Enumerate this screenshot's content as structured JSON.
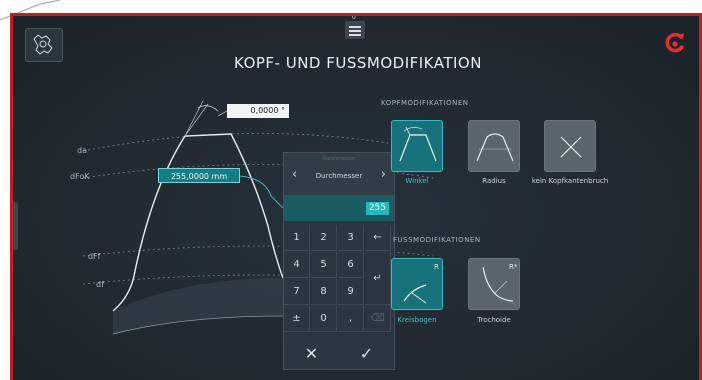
{
  "title": "KOPF- UND FUSSMODIFIKATION",
  "menu_badge": "0",
  "diagram": {
    "angle_value": "0,0000 °",
    "dfok_value": "255,0000 mm",
    "labels": {
      "da": "da",
      "dfok": "dFoK",
      "dff": "dFf",
      "df": "df"
    }
  },
  "keypad": {
    "small_caption": "Durchmesser",
    "mode_label": "Durchmesser",
    "entry_value": "255",
    "keys": [
      "1",
      "2",
      "3",
      "←",
      "4",
      "5",
      "6",
      "↵",
      "7",
      "8",
      "9",
      "",
      "±",
      "0",
      ",",
      "⌫"
    ],
    "cancel_symbol": "✕",
    "confirm_symbol": "✓"
  },
  "kopf": {
    "section_label": "KOPFMODIFIKATIONEN",
    "options": [
      {
        "label": "Winkel",
        "active": true
      },
      {
        "label": "Radius",
        "active": false
      },
      {
        "label": "kein Kopfkantenbruch",
        "active": false
      }
    ]
  },
  "fuss": {
    "section_label": "FUSSMODIFIKATIONEN",
    "options": [
      {
        "label": "Kreisbogen",
        "active": true,
        "badge": "R"
      },
      {
        "label": "Trochoide",
        "active": false,
        "badge": "R*"
      }
    ]
  },
  "colors": {
    "accent": "#17727b",
    "accent_border": "#3bb8c2",
    "frame": "#c41f1f",
    "brand": "#e03030"
  }
}
